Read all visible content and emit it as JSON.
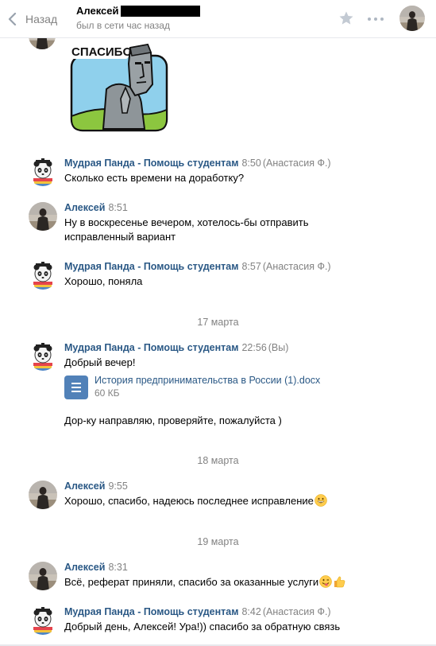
{
  "header": {
    "back_label": "Назад",
    "contact_name": "Алексей",
    "contact_status": "был в сети час назад"
  },
  "sticker": {
    "text": "СПАСИБО"
  },
  "messages": [
    {
      "author": "Мудрая Панда - Помощь студентам",
      "time": "8:50",
      "who": "(Анастасия Ф.)",
      "text": "Сколько есть времени на доработку?"
    },
    {
      "author": "Алексей",
      "time": "8:51",
      "who": "",
      "text1": "Ну в воскресенье вечером, хотелось-бы отправить",
      "text2": "исправленный вариант"
    },
    {
      "author": "Мудрая Панда - Помощь студентам",
      "time": "8:57",
      "who": "(Анастасия Ф.)",
      "text": "Хорошо, поняла"
    },
    {
      "author": "Мудрая Панда - Помощь студентам",
      "time": "22:56",
      "who": "(Вы)",
      "text": "Добрый вечер!",
      "text_after": "Дор-ку направляю, проверяйте, пожалуйста )"
    },
    {
      "author": "Алексей",
      "time": "9:55",
      "who": "",
      "text": "Хорошо, спасибо, надеюсь последнее исправление"
    },
    {
      "author": "Алексей",
      "time": "8:31",
      "who": "",
      "text": "Всё, реферат приняли, спасибо за оказанные услуги"
    },
    {
      "author": "Мудрая Панда - Помощь студентам",
      "time": "8:42",
      "who": "(Анастасия Ф.)",
      "text": "Добрый день, Алексей! Ура!)) спасибо за обратную связь"
    }
  ],
  "dates": [
    "17 марта",
    "18 марта",
    "19 марта"
  ],
  "attachment": {
    "name": "История предпринимательства в России (1).docx",
    "size": "60 КБ"
  },
  "icons": {
    "back": "chevron-left-icon",
    "favorite": "star-icon",
    "more": "more-dots-icon",
    "file": "document-icon",
    "emoji_grin": "grinning-face-icon",
    "emoji_wink": "winking-tongue-face-icon",
    "emoji_thumb": "thumbs-up-icon"
  },
  "colors": {
    "link": "#2a5885",
    "secondary": "#828282",
    "file_icon": "#5181b8"
  }
}
